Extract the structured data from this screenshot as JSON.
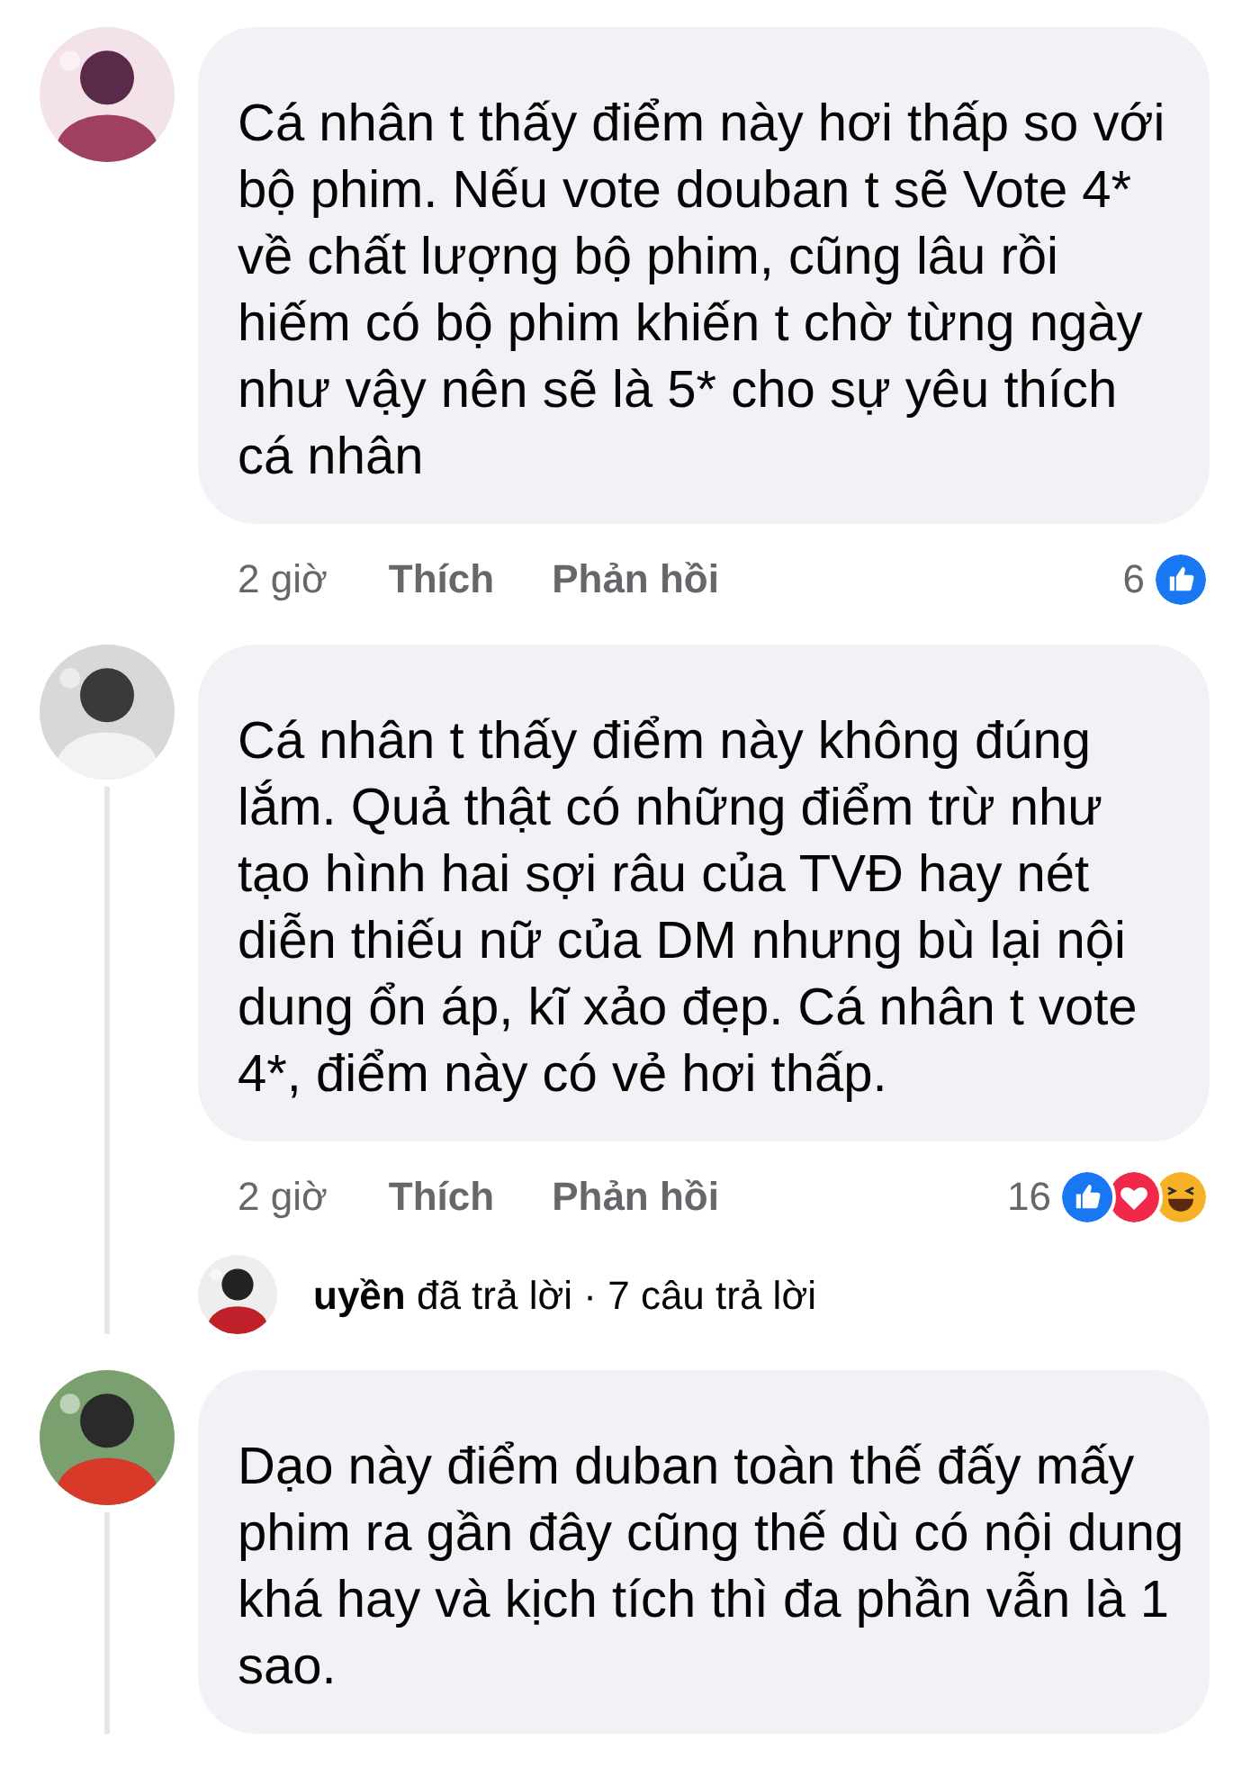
{
  "comments": [
    {
      "text": "Cá nhân t thấy điểm này hơi thấp so với bộ phim. Nếu vote douban t sẽ Vote 4* về chất lượng bộ phim, cũng lâu rồi hiếm có bộ phim khiến t chờ từng ngày như vậy nên sẽ là 5* cho sự yêu thích cá nhân",
      "time": "2 giờ",
      "like_label": "Thích",
      "reply_label": "Phản hồi",
      "reaction_count": "6",
      "reactions": [
        {
          "kind": "like"
        }
      ]
    },
    {
      "text": "Cá nhân t thấy điểm này không đúng lắm. Quả thật có những điểm trừ như tạo hình hai sợi râu của TVĐ hay nét diễn thiếu nữ của DM nhưng bù lại nội dung ổn áp, kĩ xảo đẹp. Cá nhân t vote 4*, điểm này có vẻ hơi thấp.",
      "time": "2 giờ",
      "like_label": "Thích",
      "reply_label": "Phản hồi",
      "reaction_count": "16",
      "reactions": [
        {
          "kind": "like"
        },
        {
          "kind": "love"
        },
        {
          "kind": "haha"
        }
      ],
      "reply_summary": "**uyền** đã trả lời · 7 câu trả lời"
    },
    {
      "text": "Dạo này điểm duban toàn thế đấy mấy phim ra gần đây cũng thế dù có nội dung khá hay và kịch tích thì đa phần vẫn là 1 sao."
    }
  ]
}
